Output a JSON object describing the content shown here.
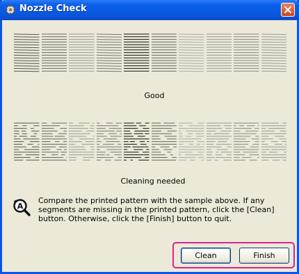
{
  "window": {
    "title": "Nozzle Check",
    "icon": "printer-utility-icon",
    "close_icon": "close-icon"
  },
  "patterns": {
    "good_caption": "Good",
    "bad_caption": "Cleaning needed"
  },
  "message": "Compare the printed pattern with the sample above. If any segments are missing in the printed pattern, click the [Clean] button. Otherwise, click the [Finish] button to quit.",
  "buttons": {
    "clean": "Clean",
    "finish": "Finish"
  },
  "colors": {
    "title_bar": "#0a5ee8",
    "window_bg": "#ece9d8",
    "highlight": "#e0208f"
  }
}
